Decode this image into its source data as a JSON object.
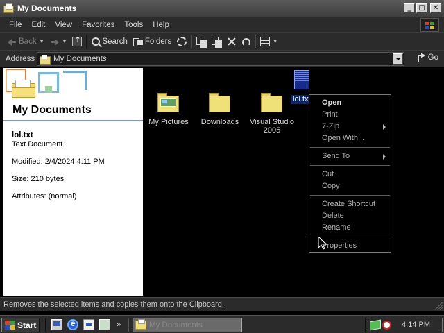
{
  "window": {
    "title": "My Documents",
    "buttons": {
      "minimize": "_",
      "maximize": "□",
      "close": "✕"
    }
  },
  "menubar": {
    "items": [
      "File",
      "Edit",
      "View",
      "Favorites",
      "Tools",
      "Help"
    ]
  },
  "toolbar": {
    "back_label": "Back",
    "search_label": "Search",
    "folders_label": "Folders"
  },
  "address": {
    "label": "Address",
    "value": "My Documents",
    "go_label": "Go"
  },
  "left_panel": {
    "title": "My Documents",
    "selected_name": "lol.txt",
    "selected_type": "Text Document",
    "modified": "Modified: 2/4/2024 4:11 PM",
    "size": "Size: 210 bytes",
    "attributes": "Attributes: (normal)"
  },
  "files": [
    {
      "name": "My Pictures",
      "icon": "my-pictures-folder-icon"
    },
    {
      "name": "Downloads",
      "icon": "folder-icon"
    },
    {
      "name": "Visual Studio 2005",
      "icon": "folder-icon"
    }
  ],
  "selected_file": {
    "name": "lol.txt",
    "icon": "text-file-icon"
  },
  "context_menu": {
    "open": "Open",
    "print": "Print",
    "sevenzip": "7-Zip",
    "open_with": "Open With...",
    "send_to": "Send To",
    "cut": "Cut",
    "copy": "Copy",
    "create_shortcut": "Create Shortcut",
    "delete": "Delete",
    "rename": "Rename",
    "properties": "Properties"
  },
  "statusbar": {
    "text": "Removes the selected items and copies them onto the Clipboard."
  },
  "taskbar": {
    "start_label": "Start",
    "more": "»",
    "task_label": "My Documents",
    "clock": "4:14 PM"
  },
  "colors": {
    "window_bg": "#000000",
    "chrome": "#2b2b2b",
    "selection": "#0a246a",
    "left_panel_bg": "#ffffff",
    "panel_rule": "#7a9acb"
  }
}
